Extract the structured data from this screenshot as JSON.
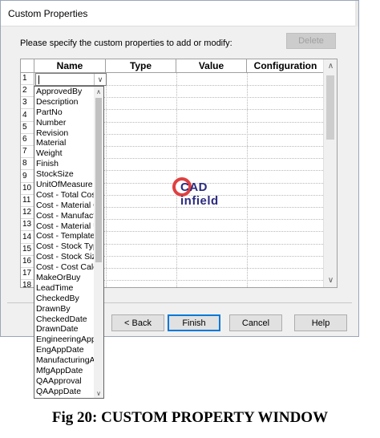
{
  "window": {
    "title": "Custom Properties"
  },
  "prompt": "Please specify the custom properties to add or modify:",
  "buttons": {
    "delete": "Delete",
    "back": "< Back",
    "finish": "Finish",
    "cancel": "Cancel",
    "help": "Help"
  },
  "grid": {
    "columns": [
      "Name",
      "Type",
      "Value",
      "Configuration"
    ],
    "row_numbers": [
      "1",
      "2",
      "3",
      "4",
      "5",
      "6",
      "7",
      "8",
      "9",
      "10",
      "11",
      "12",
      "13",
      "14",
      "15",
      "16",
      "17",
      "18"
    ]
  },
  "dropdown": {
    "items": [
      "ApprovedBy",
      "Description",
      "PartNo",
      "Number",
      "Revision",
      "Material",
      "Weight",
      "Finish",
      "StockSize",
      "UnitOfMeasure",
      "Cost - Total Cost",
      "Cost - Material Cost",
      "Cost - Manufacturing Cost",
      "Cost - Material Used",
      "Cost - Template",
      "Cost - Stock Type",
      "Cost - Stock Size",
      "Cost - Cost Calc",
      "MakeOrBuy",
      "LeadTime",
      "CheckedBy",
      "DrawnBy",
      "CheckedDate",
      "DrawnDate",
      "EngineeringApproval",
      "EngAppDate",
      "ManufacturingApproval",
      "MfgAppDate",
      "QAApproval",
      "QAAppDate"
    ]
  },
  "watermark": {
    "text": "CAD infield"
  },
  "caption": "Fig 20: CUSTOM PROPERTY WINDOW",
  "colors": {
    "accent": "#0078d7",
    "logo_red": "#e04040",
    "logo_navy": "#2b2b80"
  }
}
